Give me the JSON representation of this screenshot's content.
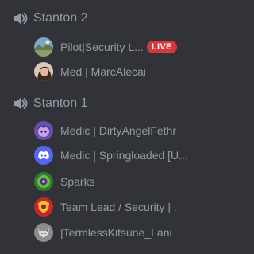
{
  "channels": [
    {
      "name": "Stanton 2",
      "icon": "speaker-icon",
      "users": [
        {
          "name": "Pilot|Security L...",
          "avatar": "landscape-avatar",
          "badge": "LIVE"
        },
        {
          "name": "Med | MarcAlecai",
          "avatar": "portrait-avatar"
        }
      ]
    },
    {
      "name": "Stanton 1",
      "icon": "speaker-icon",
      "users": [
        {
          "name": "Medic | DirtyAngelFethr",
          "avatar": "anime-avatar"
        },
        {
          "name": "Medic | Springloaded [U...",
          "avatar": "discord-default-avatar"
        },
        {
          "name": "Sparks",
          "avatar": "green-emblem-avatar"
        },
        {
          "name": "Team Lead / Security | ...",
          "avatar": "red-emblem-avatar"
        },
        {
          "name": "|TermlessKitsune_Lani",
          "avatar": "grey-fox-avatar"
        }
      ]
    }
  ],
  "colors": {
    "background": "#313338",
    "text": "#949ba4",
    "live_badge": "#da373c",
    "discord_blurple": "#5865f2"
  }
}
